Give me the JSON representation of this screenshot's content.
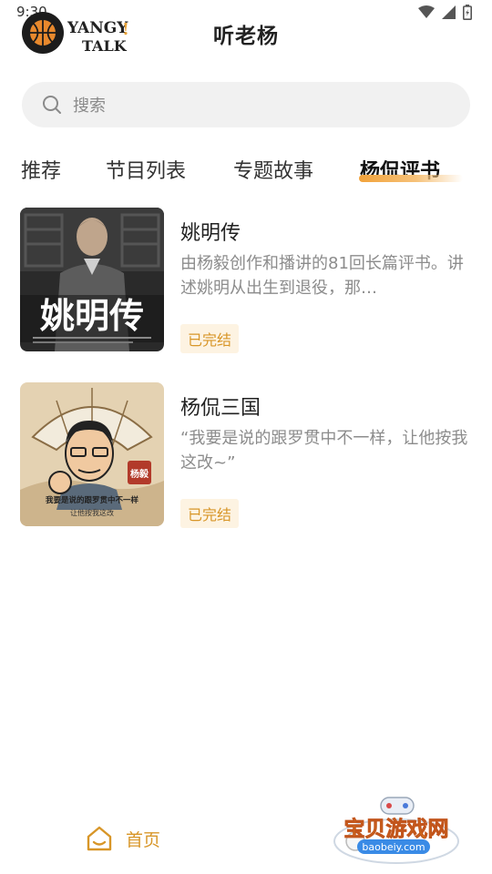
{
  "status": {
    "time": "9:30"
  },
  "header": {
    "logo_text_top": "YANGY",
    "logo_text_bottom": "TALK",
    "title": "听老杨"
  },
  "search": {
    "placeholder": "搜索"
  },
  "tabs": [
    {
      "label": "推荐",
      "active": false
    },
    {
      "label": "节目列表",
      "active": false
    },
    {
      "label": "专题故事",
      "active": false
    },
    {
      "label": "杨侃评书",
      "active": true
    }
  ],
  "items": [
    {
      "title": "姚明传",
      "description": "由杨毅创作和播讲的81回长篇评书。讲述姚明从出生到退役，那…",
      "badge": "已完结",
      "cover_text": "姚明传"
    },
    {
      "title": "杨侃三国",
      "description": "“我要是说的跟罗贯中不一样，让他按我这改~”",
      "badge": "已完结",
      "cover_text_line1": "我要是说的跟罗贯中不一样",
      "cover_text_line2": "让他按我这改",
      "cover_seal": "杨毅"
    }
  ],
  "bottom_nav": {
    "home_label": "首页"
  },
  "watermark": {
    "title": "宝贝游戏网",
    "url": "baobeiy.com"
  },
  "colors": {
    "accent": "#d89628",
    "badge_bg": "#fdf3e2",
    "search_bg": "#f1f1f1"
  },
  "icons": [
    "wifi-icon",
    "signal-icon",
    "battery-icon",
    "search-icon",
    "home-icon",
    "basketball-icon"
  ]
}
